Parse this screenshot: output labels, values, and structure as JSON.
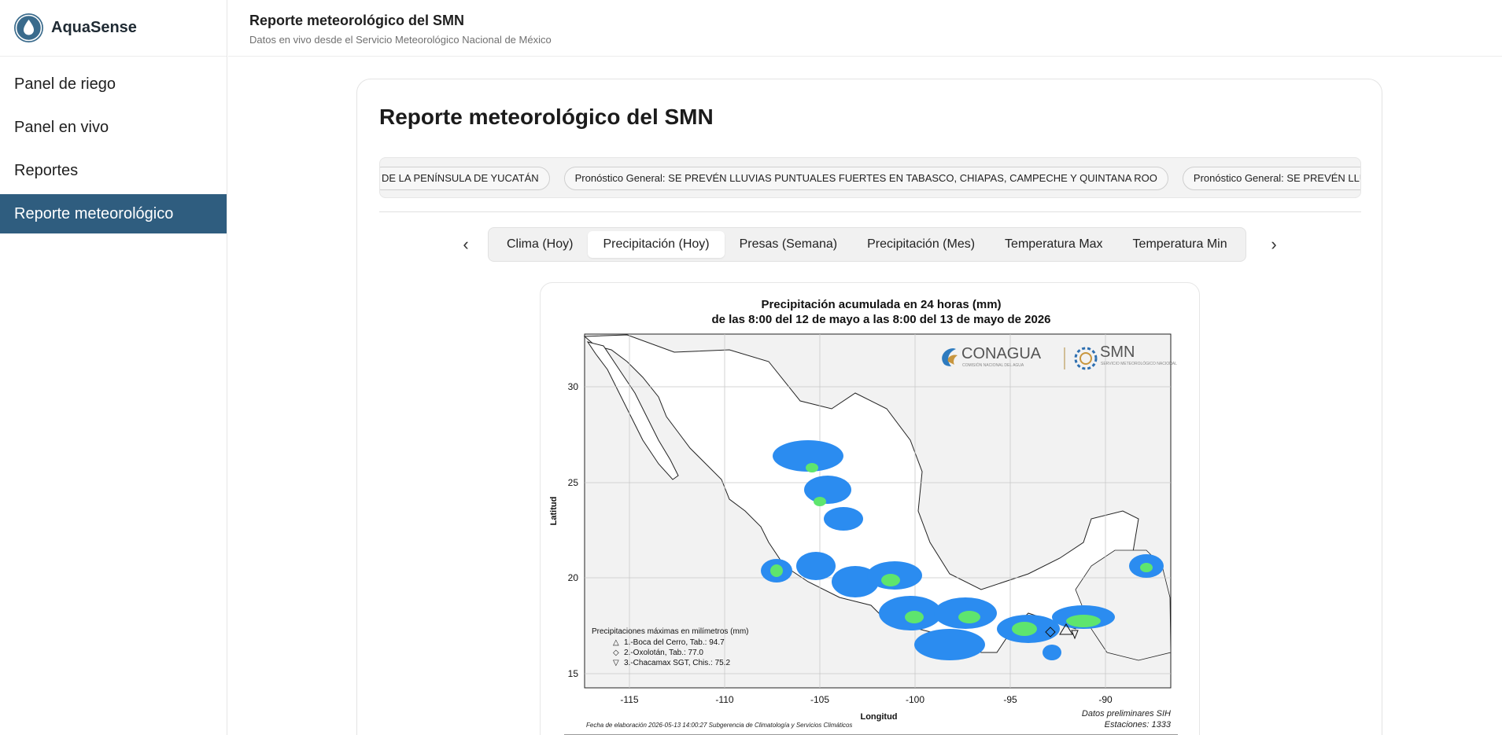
{
  "app": {
    "name": "AquaSense"
  },
  "sidebar": {
    "items": [
      {
        "label": "Panel de riego",
        "active": false
      },
      {
        "label": "Panel en vivo",
        "active": false
      },
      {
        "label": "Reportes",
        "active": false
      },
      {
        "label": "Reporte meteorológico",
        "active": true
      }
    ]
  },
  "header": {
    "title": "Reporte meteorológico del SMN",
    "subtitle": "Datos en vivo desde el Servicio Meteorológico Nacional de México"
  },
  "main": {
    "title": "Reporte meteorológico del SMN",
    "ticker": [
      "DE LA PENÍNSULA DE YUCATÁN",
      "Pronóstico General: SE PREVÉN LLUVIAS PUNTUALES FUERTES EN TABASCO, CHIAPAS, CAMPECHE Y QUINTANA ROO",
      "Pronóstico General: SE PREVÉN LLUVIAS PUNTUALES"
    ],
    "tabs": [
      {
        "label": "Clima (Hoy)",
        "active": false
      },
      {
        "label": "Precipitación (Hoy)",
        "active": true
      },
      {
        "label": "Presas (Semana)",
        "active": false
      },
      {
        "label": "Precipitación (Mes)",
        "active": false
      },
      {
        "label": "Temperatura Max",
        "active": false
      },
      {
        "label": "Temperatura Min",
        "active": false
      }
    ],
    "prev_arrow": "‹",
    "next_arrow": "›"
  },
  "map": {
    "title_line1": "Precipitación acumulada en 24 horas (mm)",
    "title_line2": "de las 8:00 del 12 de mayo a las 8:00 del 13 de mayo de 2026",
    "x_axis_label": "Longitud",
    "y_axis_label": "Latitud",
    "x_ticks": [
      "-115",
      "-110",
      "-105",
      "-100",
      "-95",
      "-90"
    ],
    "y_ticks": [
      "30",
      "25",
      "20",
      "15"
    ],
    "logo_conagua": "CONAGUA",
    "logo_conagua_sub": "COMISIÓN NACIONAL DEL AGUA",
    "logo_smn": "SMN",
    "logo_smn_sub": "SERVICIO METEOROLÓGICO NACIONAL",
    "legend_title": "Precipitaciones máximas en milímetros (mm)",
    "legend_items": [
      {
        "symbol": "△",
        "text": "1.-Boca del Cerro, Tab.: 94.7"
      },
      {
        "symbol": "◇",
        "text": "2.-Oxolotán, Tab.: 77.0"
      },
      {
        "symbol": "▽",
        "text": "3.-Chacamax SGT, Chis.: 75.2"
      }
    ],
    "footer_left": "Fecha de elaboración 2026-05-13 14:00:27 Subgerencia de Climatología y Servicios Climáticos",
    "footer_right_line1": "Datos preliminares SIH",
    "footer_right_line2": "Estaciones:  1333",
    "colors": {
      "blue": "#2b8cf0",
      "green": "#5ee56e",
      "lime": "#3fcf3f",
      "land": "#ffffff",
      "water": "#ffffff",
      "grid": "#c8c8c8"
    }
  }
}
